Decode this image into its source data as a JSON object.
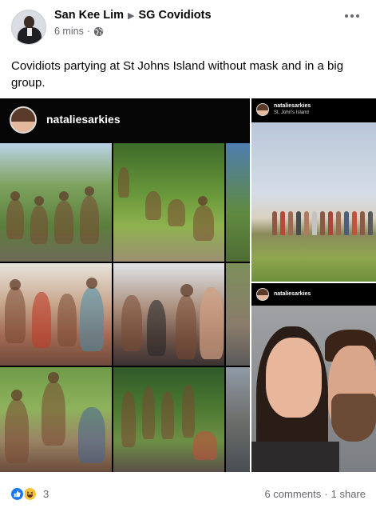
{
  "post": {
    "author": "San Kee Lim",
    "group": "SG Covidiots",
    "timestamp": "6 mins",
    "separator": "·",
    "privacy_icon": "globe-icon",
    "text": "Covidiots partying at St Johns Island without mask and in a big group."
  },
  "photos": {
    "left": {
      "username": "nataliesarkies"
    },
    "right_top": {
      "username": "nataliesarkies",
      "location": "St. John's Island"
    },
    "right_bottom": {
      "username": "nataliesarkies"
    }
  },
  "footer": {
    "reactions": [
      "like-icon",
      "haha-icon"
    ],
    "reaction_count": "3",
    "comments": "6 comments",
    "dot": "·",
    "shares": "1 share"
  },
  "colors": {
    "accent": "#1877f2",
    "secondary_text": "#65676b",
    "haha": "#f7c238"
  }
}
